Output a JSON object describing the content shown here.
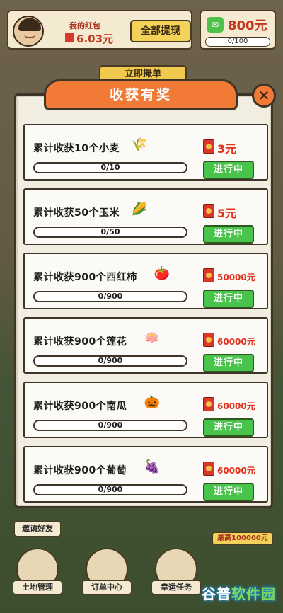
{
  "header": {
    "wallet_label": "我的红包",
    "wallet_amount": "6.03元",
    "withdraw_label": "全部提现",
    "cash_amount": "800元",
    "cash_progress": "0/100"
  },
  "behind_button_label": "立即撮单",
  "modal": {
    "title": "收获有奖",
    "close_label": "✕",
    "tasks": [
      {
        "name": "累计收获10个小麦",
        "icon": "🌾",
        "progress": "0/10",
        "reward": "3元",
        "status": "进行中"
      },
      {
        "name": "累计收获50个玉米",
        "icon": "🌽",
        "progress": "0/50",
        "reward": "5元",
        "status": "进行中"
      },
      {
        "name": "累计收获900个西红柿",
        "icon": "🍅",
        "progress": "0/900",
        "reward": "50000元",
        "status": "进行中"
      },
      {
        "name": "累计收获900个莲花",
        "icon": "🪷",
        "progress": "0/900",
        "reward": "60000元",
        "status": "进行中"
      },
      {
        "name": "累计收获900个南瓜",
        "icon": "🎃",
        "progress": "0/900",
        "reward": "60000元",
        "status": "进行中"
      },
      {
        "name": "累计收获900个葡萄",
        "icon": "🍇",
        "progress": "0/900",
        "reward": "60000元",
        "status": "进行中"
      }
    ]
  },
  "bottom_nav": {
    "invite_label": "邀请好友",
    "max_badge": "最高100000元",
    "items": [
      {
        "label": "土地管理"
      },
      {
        "label": "订单中心"
      },
      {
        "label": "幸运任务"
      }
    ]
  },
  "watermark": {
    "part1": "谷普",
    "part2": "软件园"
  }
}
